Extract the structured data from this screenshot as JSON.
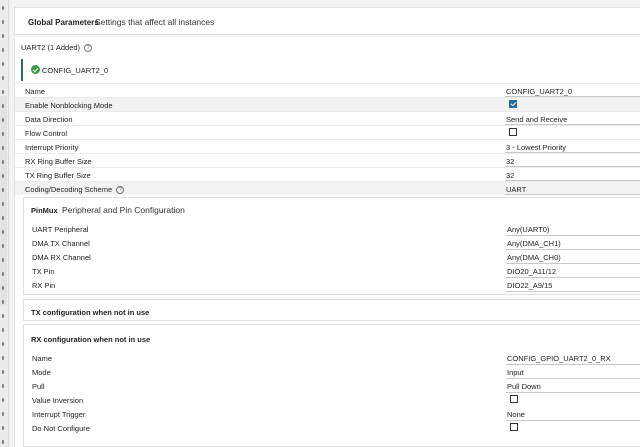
{
  "global": {
    "title": "Global Parameters",
    "desc": "Settings that affect all instances"
  },
  "uart": {
    "title": "UART2 (1 Added)",
    "instance": "CONFIG_UART2_0",
    "rows": [
      {
        "label": "Name",
        "value": "CONFIG_UART2_0"
      },
      {
        "label": "Enable Nonblocking Mode",
        "checked": true
      },
      {
        "label": "Data Direction",
        "value": "Send and Receive"
      },
      {
        "label": "Flow Control",
        "checked": false
      },
      {
        "label": "Interrupt Priority",
        "value": "3 - Lowest Priority"
      },
      {
        "label": "RX Ring Buffer Size",
        "value": "32"
      },
      {
        "label": "TX Ring Buffer Size",
        "value": "32"
      },
      {
        "label": "Coding/Decoding Scheme",
        "value": "UART"
      }
    ]
  },
  "pinmux": {
    "title": "PinMux",
    "desc": "Peripheral and Pin Configuration",
    "rows": [
      {
        "label": "UART Peripheral",
        "value": "Any(UART0)"
      },
      {
        "label": "DMA TX Channel",
        "value": "Any(DMA_CH1)"
      },
      {
        "label": "DMA RX Channel",
        "value": "Any(DMA_CH0)"
      },
      {
        "label": "TX Pin",
        "value": "DIO20_A11/12"
      },
      {
        "label": "RX Pin",
        "value": "DIO22_A9/15"
      }
    ]
  },
  "tx_config": {
    "title": "TX configuration when not in use"
  },
  "rx_config": {
    "title": "RX configuration when not in use",
    "rows": [
      {
        "label": "Name",
        "value": "CONFIG_GPIO_UART2_0_RX"
      },
      {
        "label": "Mode",
        "value": "Input"
      },
      {
        "label": "Pull",
        "value": "Pull Down"
      },
      {
        "label": "Value Inversion",
        "checked": false
      },
      {
        "label": "Interrupt Trigger",
        "value": "None"
      },
      {
        "label": "Do Not Configure",
        "checked": false
      }
    ]
  }
}
